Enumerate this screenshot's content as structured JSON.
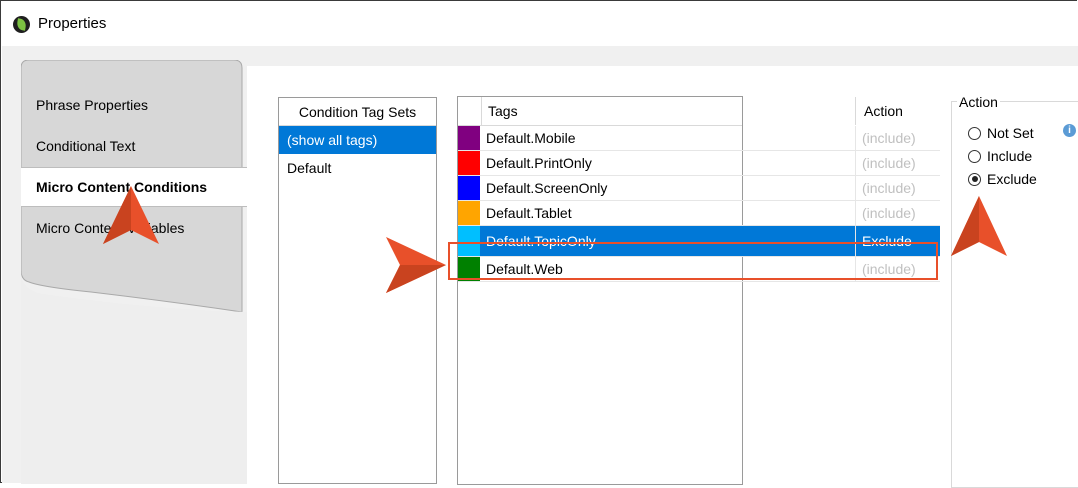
{
  "window": {
    "title": "Properties"
  },
  "tabs": [
    {
      "label": "Phrase Properties"
    },
    {
      "label": "Conditional Text"
    },
    {
      "label": "Micro Content Conditions",
      "active": true
    },
    {
      "label": "Micro Content Variables"
    }
  ],
  "tag_sets": {
    "header": "Condition Tag Sets",
    "items": [
      {
        "label": "(show all tags)",
        "selected": true
      },
      {
        "label": "Default",
        "selected": false
      }
    ]
  },
  "tags_grid": {
    "columns": [
      "Tags",
      "Action"
    ],
    "rows": [
      {
        "name": "Default.Mobile",
        "color": "#800080",
        "action": "(include)"
      },
      {
        "name": "Default.PrintOnly",
        "color": "#ff0000",
        "action": "(include)"
      },
      {
        "name": "Default.ScreenOnly",
        "color": "#0000ff",
        "action": "(include)"
      },
      {
        "name": "Default.Tablet",
        "color": "#ffa500",
        "action": "(include)"
      },
      {
        "name": "Default.TopicOnly",
        "color": "#00bfff",
        "action": "Exclude",
        "selected": true
      },
      {
        "name": "Default.Web",
        "color": "#008000",
        "action": "(include)"
      }
    ]
  },
  "action_group": {
    "legend": "Action",
    "options": [
      {
        "label": "Not Set",
        "checked": false
      },
      {
        "label": "Include",
        "checked": false
      },
      {
        "label": "Exclude",
        "checked": true
      }
    ]
  },
  "colors": {
    "selection": "#0078d7",
    "callout": "#e8502a"
  }
}
